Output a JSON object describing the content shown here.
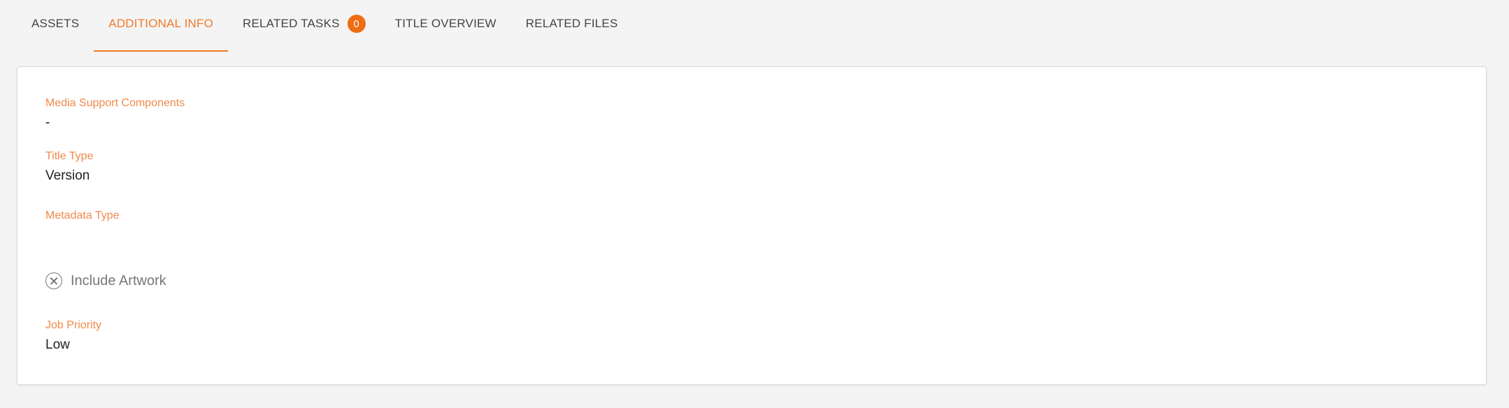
{
  "tabs": [
    {
      "label": "ASSETS",
      "active": false
    },
    {
      "label": "ADDITIONAL INFO",
      "active": true
    },
    {
      "label": "RELATED TASKS",
      "active": false,
      "badge": "0"
    },
    {
      "label": "TITLE OVERVIEW",
      "active": false
    },
    {
      "label": "RELATED FILES",
      "active": false
    }
  ],
  "fields": {
    "media_support_components": {
      "label": "Media Support Components",
      "value": "-"
    },
    "title_type": {
      "label": "Title Type",
      "value": "Version"
    },
    "metadata_type": {
      "label": "Metadata Type",
      "value": ""
    },
    "include_artwork": {
      "label": "Include Artwork",
      "checked": false,
      "icon": "x-circle-icon"
    },
    "job_priority": {
      "label": "Job Priority",
      "value": "Low"
    }
  },
  "colors": {
    "accent": "#f07a28",
    "label": "#f08a4b",
    "badge": "#ee6c12",
    "background": "#f4f4f4"
  }
}
